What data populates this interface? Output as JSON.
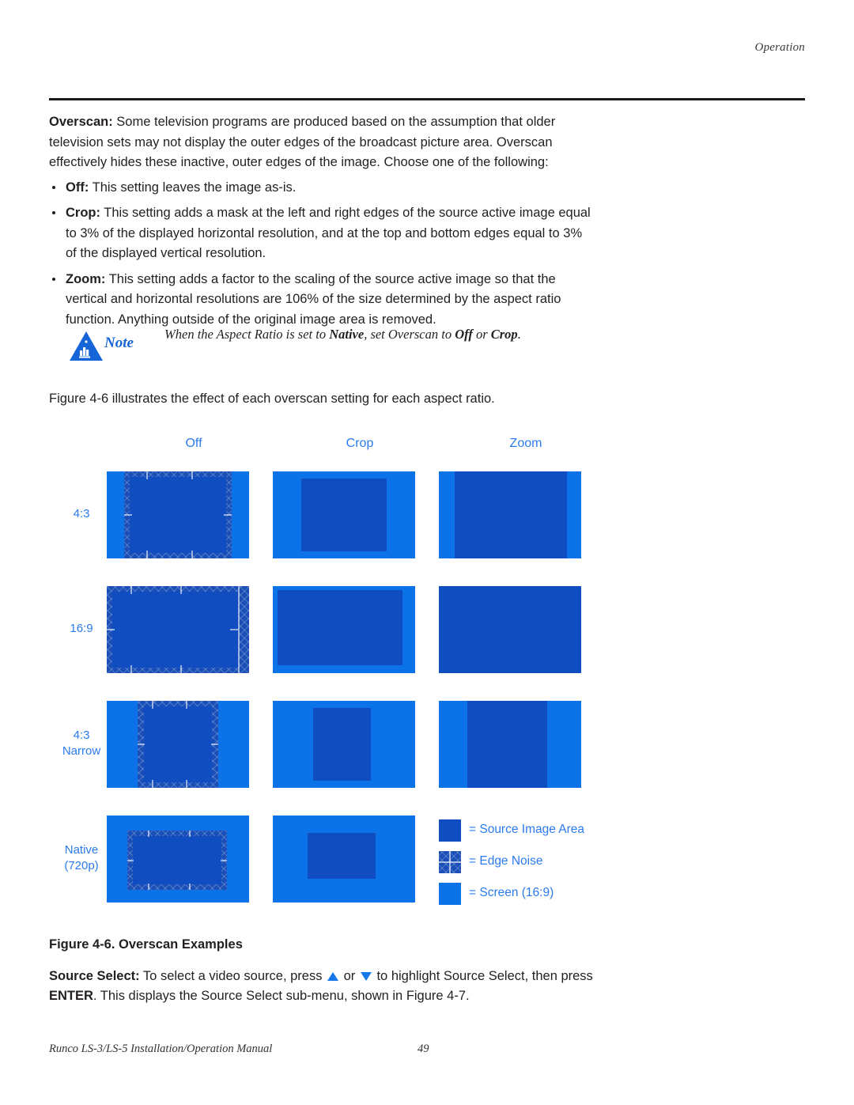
{
  "header": {
    "running_head": "Operation"
  },
  "body": {
    "overscan_label": "Overscan:",
    "overscan_paragraph": " Some television programs are produced based on the assumption that older television sets may not display the outer edges of the broadcast picture area. Overscan effectively hides these inactive, outer edges of the image. Choose one of the following:",
    "bullets": [
      {
        "term": "Off:",
        "text": " This setting leaves the image as-is."
      },
      {
        "term": "Crop:",
        "text": " This setting adds a mask at the left and right edges of the source active image equal to 3% of the displayed horizontal resolution, and at the top and bottom edges equal to 3% of the displayed vertical resolution."
      },
      {
        "term": "Zoom:",
        "text": " This setting adds a factor to the scaling of the source active image so that the vertical and horizontal resolutions are 106% of the size determined by the aspect ratio function. Anything outside of the original image area is removed."
      }
    ]
  },
  "note": {
    "icon": "warning-triangle-icon",
    "label": "Note",
    "text_pre": "When the Aspect Ratio is set to ",
    "text_native": "Native",
    "text_mid": ", set Overscan to ",
    "text_off": "Off",
    "text_or": " or ",
    "text_crop": "Crop",
    "text_end": "."
  },
  "intro_line": "Figure 4-6 illustrates the effect of each overscan setting for each aspect ratio.",
  "figure": {
    "columns": [
      "Off",
      "Crop",
      "Zoom"
    ],
    "rows": [
      "4:3",
      "16:9",
      "4:3\nNarrow",
      "Native\n(720p)"
    ],
    "row_labels": [
      {
        "line1": "4:3",
        "line2": ""
      },
      {
        "line1": "16:9",
        "line2": ""
      },
      {
        "line1": "4:3",
        "line2": "Narrow"
      },
      {
        "line1": "Native",
        "line2": "(720p)"
      }
    ],
    "legend": [
      {
        "swatch": "source-image-area-swatch",
        "label": "= Source Image Area"
      },
      {
        "swatch": "edge-noise-swatch",
        "label": "= Edge Noise"
      },
      {
        "swatch": "screen-swatch",
        "label": "= Screen (16:9)"
      }
    ],
    "colors": {
      "screen": "#0b72e7",
      "source_image_area": "#0f4dc0",
      "edge_noise": "#1a4fb8",
      "label_blue": "#2b7bed"
    }
  },
  "caption": "Figure 4-6. Overscan Examples",
  "closing": {
    "term": "Source Select:",
    "part1": " To select a video source, press ",
    "or": " or ",
    "part2": " to highlight Source Select, then press ",
    "enter": "ENTER",
    "part3": ". This displays the Source Select sub-menu, shown in Figure 4-7."
  },
  "footer": {
    "manual": "Runco LS-3/LS-5 Installation/Operation Manual",
    "page": "49"
  }
}
